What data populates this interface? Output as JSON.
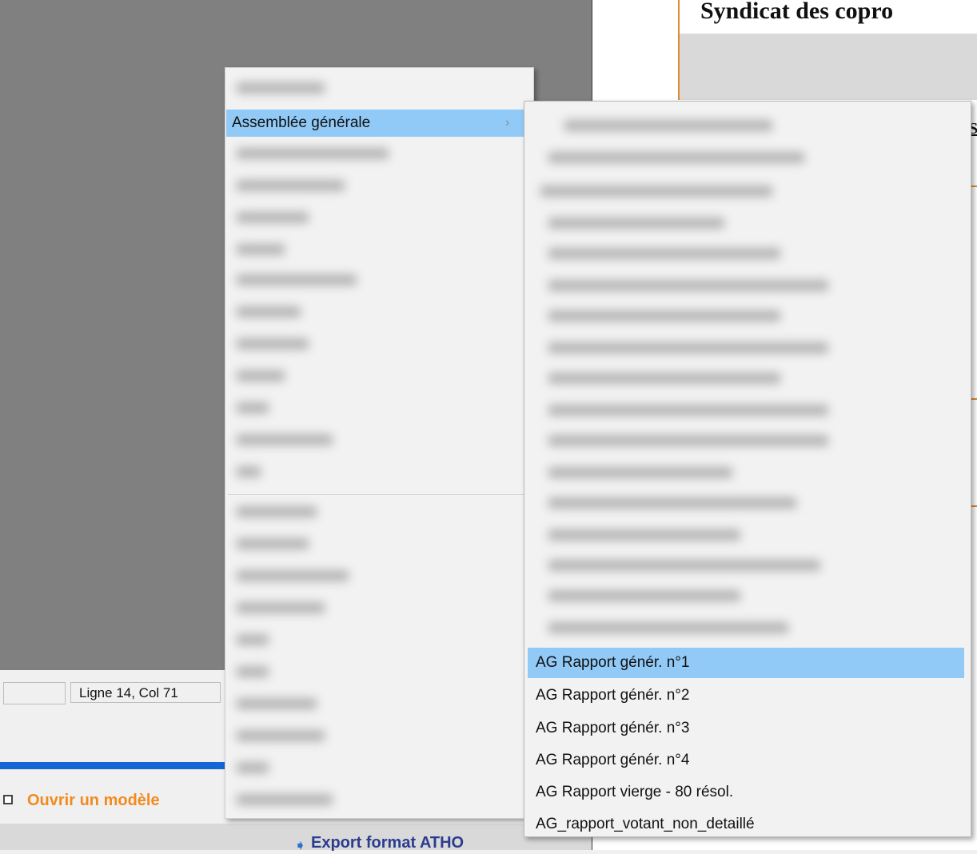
{
  "document": {
    "title": "Syndicat des copro"
  },
  "status_bar": {
    "position": "Ligne 14, Col 71"
  },
  "bottom_panel": {
    "open_template_label": "Ouvrir un modèle",
    "export_label": "Export format ATHO"
  },
  "context_menu": {
    "highlighted_item": {
      "label": "Assemblée générale",
      "arrow": "›"
    }
  },
  "submenu": {
    "items": [
      {
        "label": "AG Rapport génér. n°1",
        "active": true
      },
      {
        "label": "AG Rapport génér. n°2",
        "active": false
      },
      {
        "label": "AG Rapport génér. n°3",
        "active": false
      },
      {
        "label": "AG Rapport génér. n°4",
        "active": false
      },
      {
        "label": "AG Rapport vierge - 80 résol.",
        "active": false
      },
      {
        "label": "AG_rapport_votant_non_detaillé",
        "active": false
      }
    ]
  },
  "colors": {
    "highlight": "#91c9f7",
    "accent_orange": "#f28a1f",
    "accent_blue": "#1466d4"
  }
}
